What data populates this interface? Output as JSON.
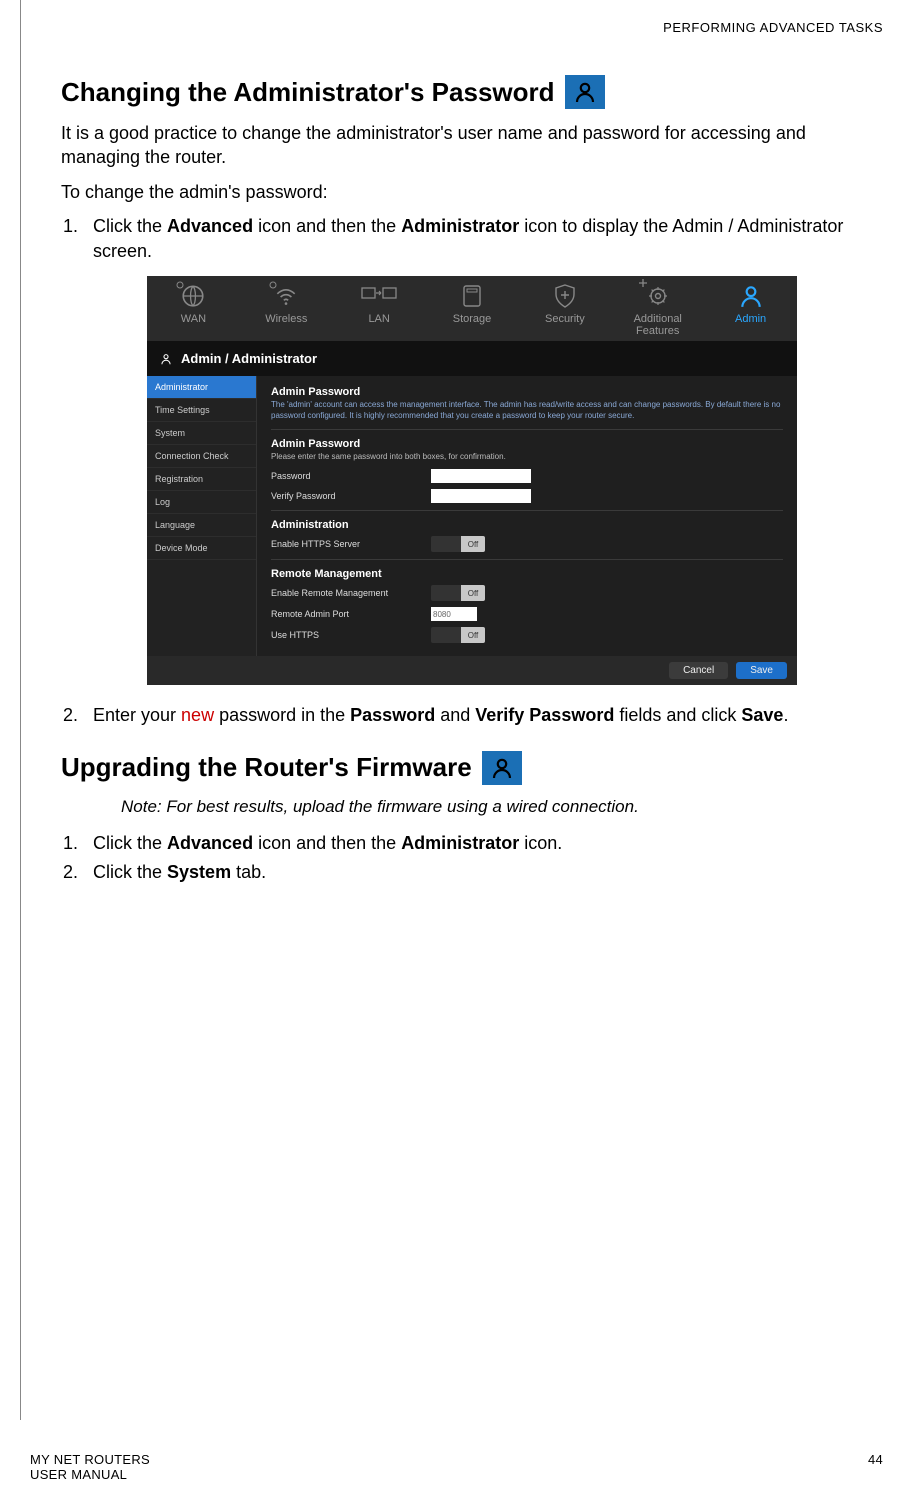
{
  "doc": {
    "header": "PERFORMING ADVANCED TASKS",
    "footer_left_1": "MY NET ROUTERS",
    "footer_left_2": "USER MANUAL",
    "page_number": "44"
  },
  "section1": {
    "title": "Changing the Administrator's Password",
    "intro": "It is a good practice to change the administrator's user name and password for accessing and managing the router.",
    "lead": "To change the admin's password:",
    "step1_pre": "Click the ",
    "step1_b1": "Advanced",
    "step1_mid": " icon and then the ",
    "step1_b2": "Administrator",
    "step1_post": " icon to display the Admin / Administrator screen.",
    "step2_pre": "Enter your ",
    "step2_new": "new",
    "step2_mid1": " password in the ",
    "step2_b1": "Password",
    "step2_mid2": " and ",
    "step2_b2": "Verify Password",
    "step2_mid3": " fields and click ",
    "step2_b3": "Save",
    "step2_end": "."
  },
  "section2": {
    "title": "Upgrading the Router's Firmware",
    "note_label": "Note:",
    "note_text": "  For best results, upload the firmware using a wired connection.",
    "step1_pre": "Click the ",
    "step1_b1": "Advanced",
    "step1_mid": " icon and then the ",
    "step1_b2": "Administrator",
    "step1_post": " icon.",
    "step2_pre": "Click the ",
    "step2_b1": "System",
    "step2_post": " tab."
  },
  "figure": {
    "nav": [
      "WAN",
      "Wireless",
      "LAN",
      "Storage",
      "Security",
      "Additional Features",
      "Admin"
    ],
    "breadcrumb": "Admin / Administrator",
    "sidebar": [
      "Administrator",
      "Time Settings",
      "System",
      "Connection Check",
      "Registration",
      "Log",
      "Language",
      "Device Mode"
    ],
    "sec_admin_pw_title": "Admin Password",
    "sec_admin_pw_desc": "The 'admin' account can access the management interface. The admin has read/write access and can change passwords. By default there is no password configured. It is highly recommended that you create a password to keep your router secure.",
    "sec_admin_pw_title2": "Admin Password",
    "sec_admin_pw_desc2": "Please enter the same password into both boxes, for confirmation.",
    "lbl_password": "Password",
    "lbl_verify": "Verify Password",
    "sec_admin_title": "Administration",
    "lbl_https_server": "Enable HTTPS Server",
    "sec_remote_title": "Remote Management",
    "lbl_remote_mgmt": "Enable Remote Management",
    "lbl_remote_port": "Remote Admin Port",
    "val_remote_port": "8080",
    "lbl_use_https": "Use HTTPS",
    "off": "Off",
    "btn_cancel": "Cancel",
    "btn_save": "Save"
  }
}
